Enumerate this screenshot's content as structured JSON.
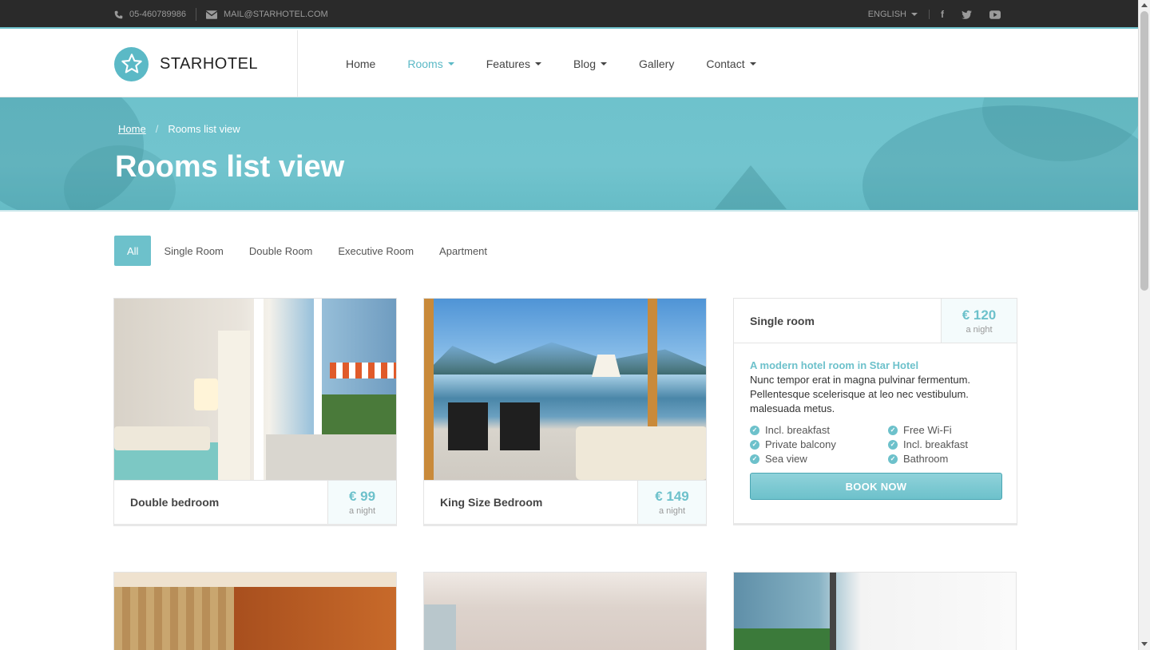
{
  "topbar": {
    "phone": "05-460789986",
    "email": "MAIL@STARHOTEL.COM",
    "language": "ENGLISH",
    "social": [
      "facebook",
      "twitter",
      "youtube"
    ]
  },
  "header": {
    "brand": "STARHOTEL",
    "nav": [
      {
        "label": "Home",
        "dropdown": false,
        "active": false
      },
      {
        "label": "Rooms",
        "dropdown": true,
        "active": true
      },
      {
        "label": "Features",
        "dropdown": true,
        "active": false
      },
      {
        "label": "Blog",
        "dropdown": true,
        "active": false
      },
      {
        "label": "Gallery",
        "dropdown": false,
        "active": false
      },
      {
        "label": "Contact",
        "dropdown": true,
        "active": false
      }
    ]
  },
  "hero": {
    "breadcrumb_home": "Home",
    "breadcrumb_sep": "/",
    "breadcrumb_current": "Rooms list view",
    "title": "Rooms list view"
  },
  "filters": [
    "All",
    "Single Room",
    "Double Room",
    "Executive Room",
    "Apartment"
  ],
  "rooms": [
    {
      "name": "Double bedroom",
      "price": "€ 99",
      "per": "a night"
    },
    {
      "name": "King Size Bedroom",
      "price": "€ 149",
      "per": "a night"
    }
  ],
  "detail": {
    "name": "Single room",
    "price": "€ 120",
    "per": "a night",
    "subtitle": "A modern hotel room in Star Hotel",
    "description": "Nunc tempor erat in magna pulvinar fermentum. Pellentesque scelerisque at leo nec vestibulum. malesuada metus.",
    "features": [
      "Incl. breakfast",
      "Free Wi-Fi",
      "Private balcony",
      "Incl. breakfast",
      "Sea view",
      "Bathroom"
    ],
    "book_label": "BOOK NOW"
  },
  "colors": {
    "accent": "#6dc1cb",
    "topbar": "#2a2a2a"
  }
}
